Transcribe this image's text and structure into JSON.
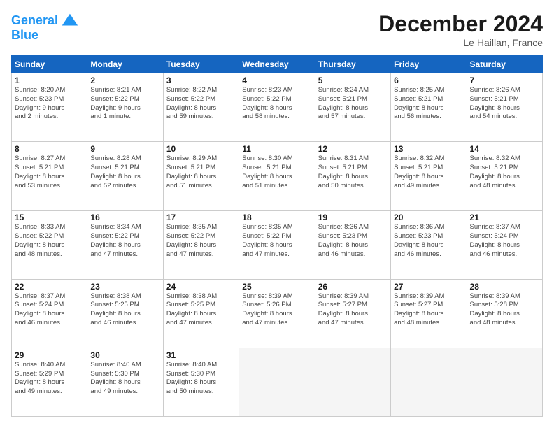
{
  "logo": {
    "line1": "General",
    "line2": "Blue"
  },
  "title": "December 2024",
  "location": "Le Haillan, France",
  "days_of_week": [
    "Sunday",
    "Monday",
    "Tuesday",
    "Wednesday",
    "Thursday",
    "Friday",
    "Saturday"
  ],
  "weeks": [
    [
      {
        "day": "1",
        "info": "Sunrise: 8:20 AM\nSunset: 5:23 PM\nDaylight: 9 hours\nand 2 minutes."
      },
      {
        "day": "2",
        "info": "Sunrise: 8:21 AM\nSunset: 5:22 PM\nDaylight: 9 hours\nand 1 minute."
      },
      {
        "day": "3",
        "info": "Sunrise: 8:22 AM\nSunset: 5:22 PM\nDaylight: 8 hours\nand 59 minutes."
      },
      {
        "day": "4",
        "info": "Sunrise: 8:23 AM\nSunset: 5:22 PM\nDaylight: 8 hours\nand 58 minutes."
      },
      {
        "day": "5",
        "info": "Sunrise: 8:24 AM\nSunset: 5:21 PM\nDaylight: 8 hours\nand 57 minutes."
      },
      {
        "day": "6",
        "info": "Sunrise: 8:25 AM\nSunset: 5:21 PM\nDaylight: 8 hours\nand 56 minutes."
      },
      {
        "day": "7",
        "info": "Sunrise: 8:26 AM\nSunset: 5:21 PM\nDaylight: 8 hours\nand 54 minutes."
      }
    ],
    [
      {
        "day": "8",
        "info": "Sunrise: 8:27 AM\nSunset: 5:21 PM\nDaylight: 8 hours\nand 53 minutes."
      },
      {
        "day": "9",
        "info": "Sunrise: 8:28 AM\nSunset: 5:21 PM\nDaylight: 8 hours\nand 52 minutes."
      },
      {
        "day": "10",
        "info": "Sunrise: 8:29 AM\nSunset: 5:21 PM\nDaylight: 8 hours\nand 51 minutes."
      },
      {
        "day": "11",
        "info": "Sunrise: 8:30 AM\nSunset: 5:21 PM\nDaylight: 8 hours\nand 51 minutes."
      },
      {
        "day": "12",
        "info": "Sunrise: 8:31 AM\nSunset: 5:21 PM\nDaylight: 8 hours\nand 50 minutes."
      },
      {
        "day": "13",
        "info": "Sunrise: 8:32 AM\nSunset: 5:21 PM\nDaylight: 8 hours\nand 49 minutes."
      },
      {
        "day": "14",
        "info": "Sunrise: 8:32 AM\nSunset: 5:21 PM\nDaylight: 8 hours\nand 48 minutes."
      }
    ],
    [
      {
        "day": "15",
        "info": "Sunrise: 8:33 AM\nSunset: 5:22 PM\nDaylight: 8 hours\nand 48 minutes."
      },
      {
        "day": "16",
        "info": "Sunrise: 8:34 AM\nSunset: 5:22 PM\nDaylight: 8 hours\nand 47 minutes."
      },
      {
        "day": "17",
        "info": "Sunrise: 8:35 AM\nSunset: 5:22 PM\nDaylight: 8 hours\nand 47 minutes."
      },
      {
        "day": "18",
        "info": "Sunrise: 8:35 AM\nSunset: 5:22 PM\nDaylight: 8 hours\nand 47 minutes."
      },
      {
        "day": "19",
        "info": "Sunrise: 8:36 AM\nSunset: 5:23 PM\nDaylight: 8 hours\nand 46 minutes."
      },
      {
        "day": "20",
        "info": "Sunrise: 8:36 AM\nSunset: 5:23 PM\nDaylight: 8 hours\nand 46 minutes."
      },
      {
        "day": "21",
        "info": "Sunrise: 8:37 AM\nSunset: 5:24 PM\nDaylight: 8 hours\nand 46 minutes."
      }
    ],
    [
      {
        "day": "22",
        "info": "Sunrise: 8:37 AM\nSunset: 5:24 PM\nDaylight: 8 hours\nand 46 minutes."
      },
      {
        "day": "23",
        "info": "Sunrise: 8:38 AM\nSunset: 5:25 PM\nDaylight: 8 hours\nand 46 minutes."
      },
      {
        "day": "24",
        "info": "Sunrise: 8:38 AM\nSunset: 5:25 PM\nDaylight: 8 hours\nand 47 minutes."
      },
      {
        "day": "25",
        "info": "Sunrise: 8:39 AM\nSunset: 5:26 PM\nDaylight: 8 hours\nand 47 minutes."
      },
      {
        "day": "26",
        "info": "Sunrise: 8:39 AM\nSunset: 5:27 PM\nDaylight: 8 hours\nand 47 minutes."
      },
      {
        "day": "27",
        "info": "Sunrise: 8:39 AM\nSunset: 5:27 PM\nDaylight: 8 hours\nand 48 minutes."
      },
      {
        "day": "28",
        "info": "Sunrise: 8:39 AM\nSunset: 5:28 PM\nDaylight: 8 hours\nand 48 minutes."
      }
    ],
    [
      {
        "day": "29",
        "info": "Sunrise: 8:40 AM\nSunset: 5:29 PM\nDaylight: 8 hours\nand 49 minutes."
      },
      {
        "day": "30",
        "info": "Sunrise: 8:40 AM\nSunset: 5:30 PM\nDaylight: 8 hours\nand 49 minutes."
      },
      {
        "day": "31",
        "info": "Sunrise: 8:40 AM\nSunset: 5:30 PM\nDaylight: 8 hours\nand 50 minutes."
      },
      {
        "day": "",
        "info": ""
      },
      {
        "day": "",
        "info": ""
      },
      {
        "day": "",
        "info": ""
      },
      {
        "day": "",
        "info": ""
      }
    ]
  ]
}
